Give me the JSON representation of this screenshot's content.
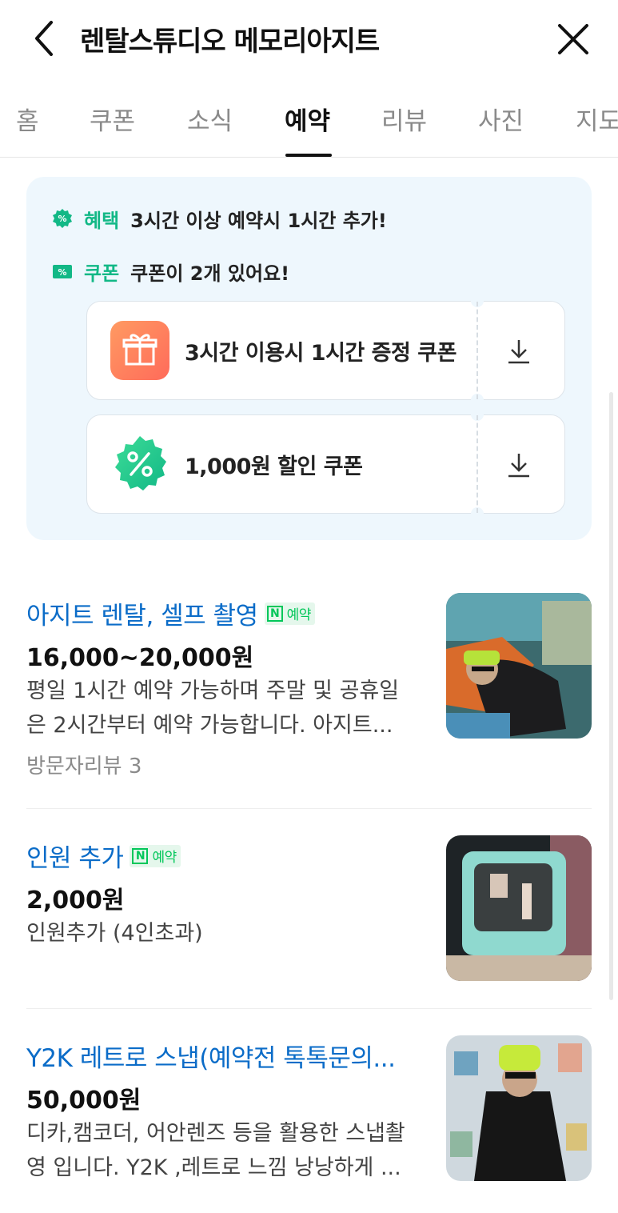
{
  "header": {
    "title": "렌탈스튜디오 메모리아지트"
  },
  "tabs": [
    {
      "label": "홈"
    },
    {
      "label": "쿠폰"
    },
    {
      "label": "소식"
    },
    {
      "label": "예약"
    },
    {
      "label": "리뷰"
    },
    {
      "label": "사진"
    },
    {
      "label": "지도"
    }
  ],
  "active_tab": "예약",
  "benefits": {
    "benefit_label": "혜택",
    "benefit_text": "3시간 이상 예약시 1시간 추가!",
    "coupon_label": "쿠폰",
    "coupon_text": "쿠폰이 2개 있어요!",
    "coupons": [
      {
        "name": "3시간 이용시 1시간 증정 쿠폰",
        "icon": "gift-icon"
      },
      {
        "name": "1,000원 할인 쿠폰",
        "icon": "percent-badge-icon"
      }
    ]
  },
  "reservation_badge": "예약",
  "products": [
    {
      "name": "아지트 렌탈, 셀프 촬영",
      "price": "16,000~20,000원",
      "desc_lines": [
        "평일 1시간 예약 가능하며 주말 및 공휴일",
        "은 2시간부터 예약 가능합니다. 아지트..."
      ],
      "meta": "방문자리뷰 3"
    },
    {
      "name": "인원 추가",
      "price": "2,000원",
      "desc_lines": [
        "인원추가 (4인초과)"
      ],
      "meta": ""
    },
    {
      "name": "Y2K 레트로 스냅(예약전 톡톡문의...",
      "price": "50,000원",
      "desc_lines": [
        "디카,캠코더, 어안렌즈 등을 활용한 스냅촬",
        "영 입니다. Y2K ,레트로 느낌 낭낭하게 ..."
      ],
      "meta": ""
    }
  ],
  "colors": {
    "accent_green": "#12b886",
    "link_blue": "#0b6cc8",
    "naver_green": "#03c75a",
    "box_bg": "#eef7fd"
  }
}
